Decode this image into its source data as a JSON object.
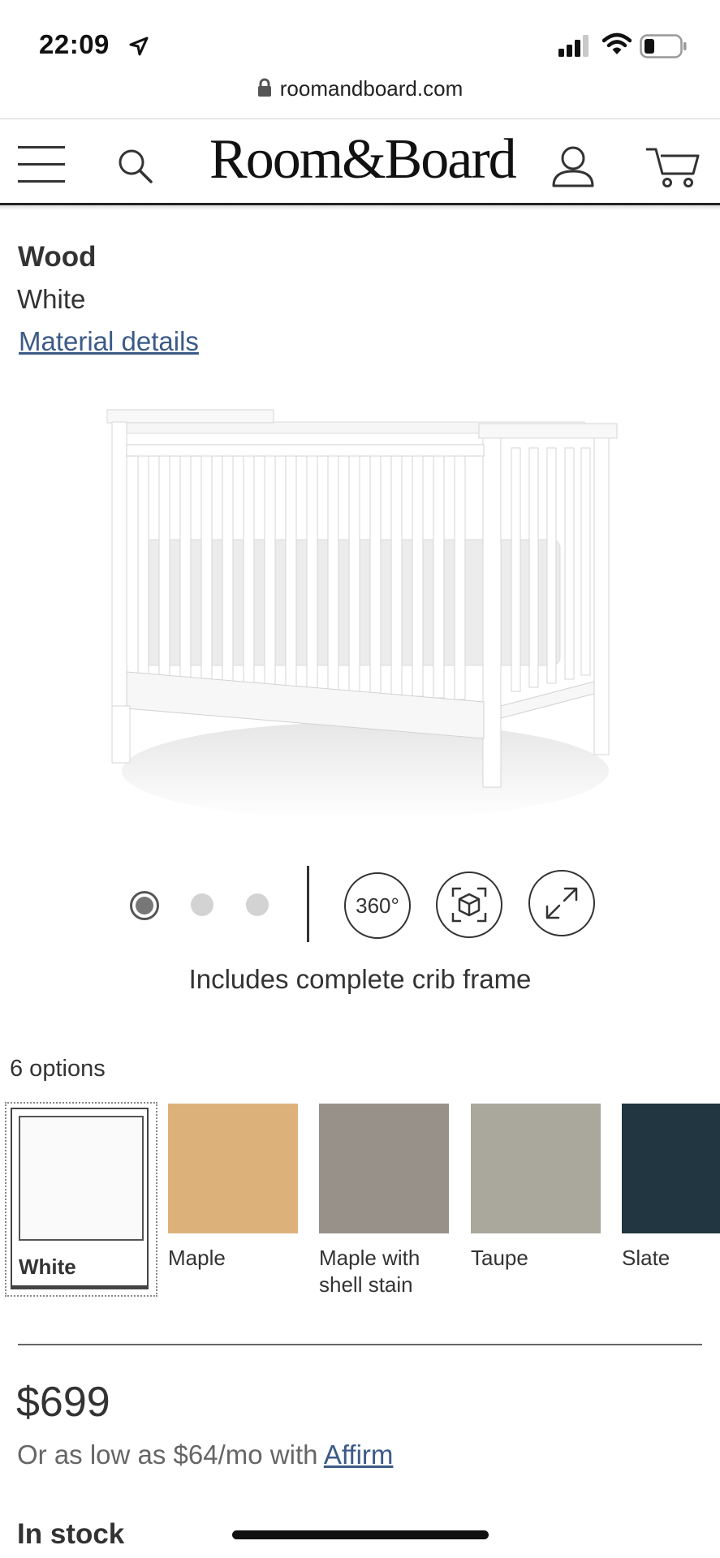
{
  "status_bar": {
    "time": "22:09",
    "icons": [
      "location-arrow-icon",
      "signal-icon",
      "wifi-icon",
      "battery-icon"
    ]
  },
  "browser": {
    "url": "roomandboard.com"
  },
  "header": {
    "logo": "Room&Board",
    "icons": [
      "menu-icon",
      "search-icon",
      "user-icon",
      "cart-icon"
    ]
  },
  "material": {
    "title": "Wood",
    "value": "White",
    "details_link": "Material details"
  },
  "carousel": {
    "slide_count": 3,
    "active_slide": 1,
    "btn_360": "360°",
    "caption": "Includes complete crib frame"
  },
  "options": {
    "count_label": "6 options",
    "swatches": [
      {
        "label": "White",
        "color": "#fafafa",
        "selected": true
      },
      {
        "label": "Maple",
        "color": "#ddb27a"
      },
      {
        "label": "Maple with shell stain",
        "color": "#97918a"
      },
      {
        "label": "Taupe",
        "color": "#aaa79c"
      },
      {
        "label": "Slate",
        "color": "#213640"
      }
    ]
  },
  "pricing": {
    "price": "$699",
    "finance_text": "Or as low as $64/mo with ",
    "finance_link": "Affirm"
  },
  "availability": {
    "stock": "In stock"
  },
  "colors": {
    "link": "#3b5a87",
    "text": "#333333"
  }
}
